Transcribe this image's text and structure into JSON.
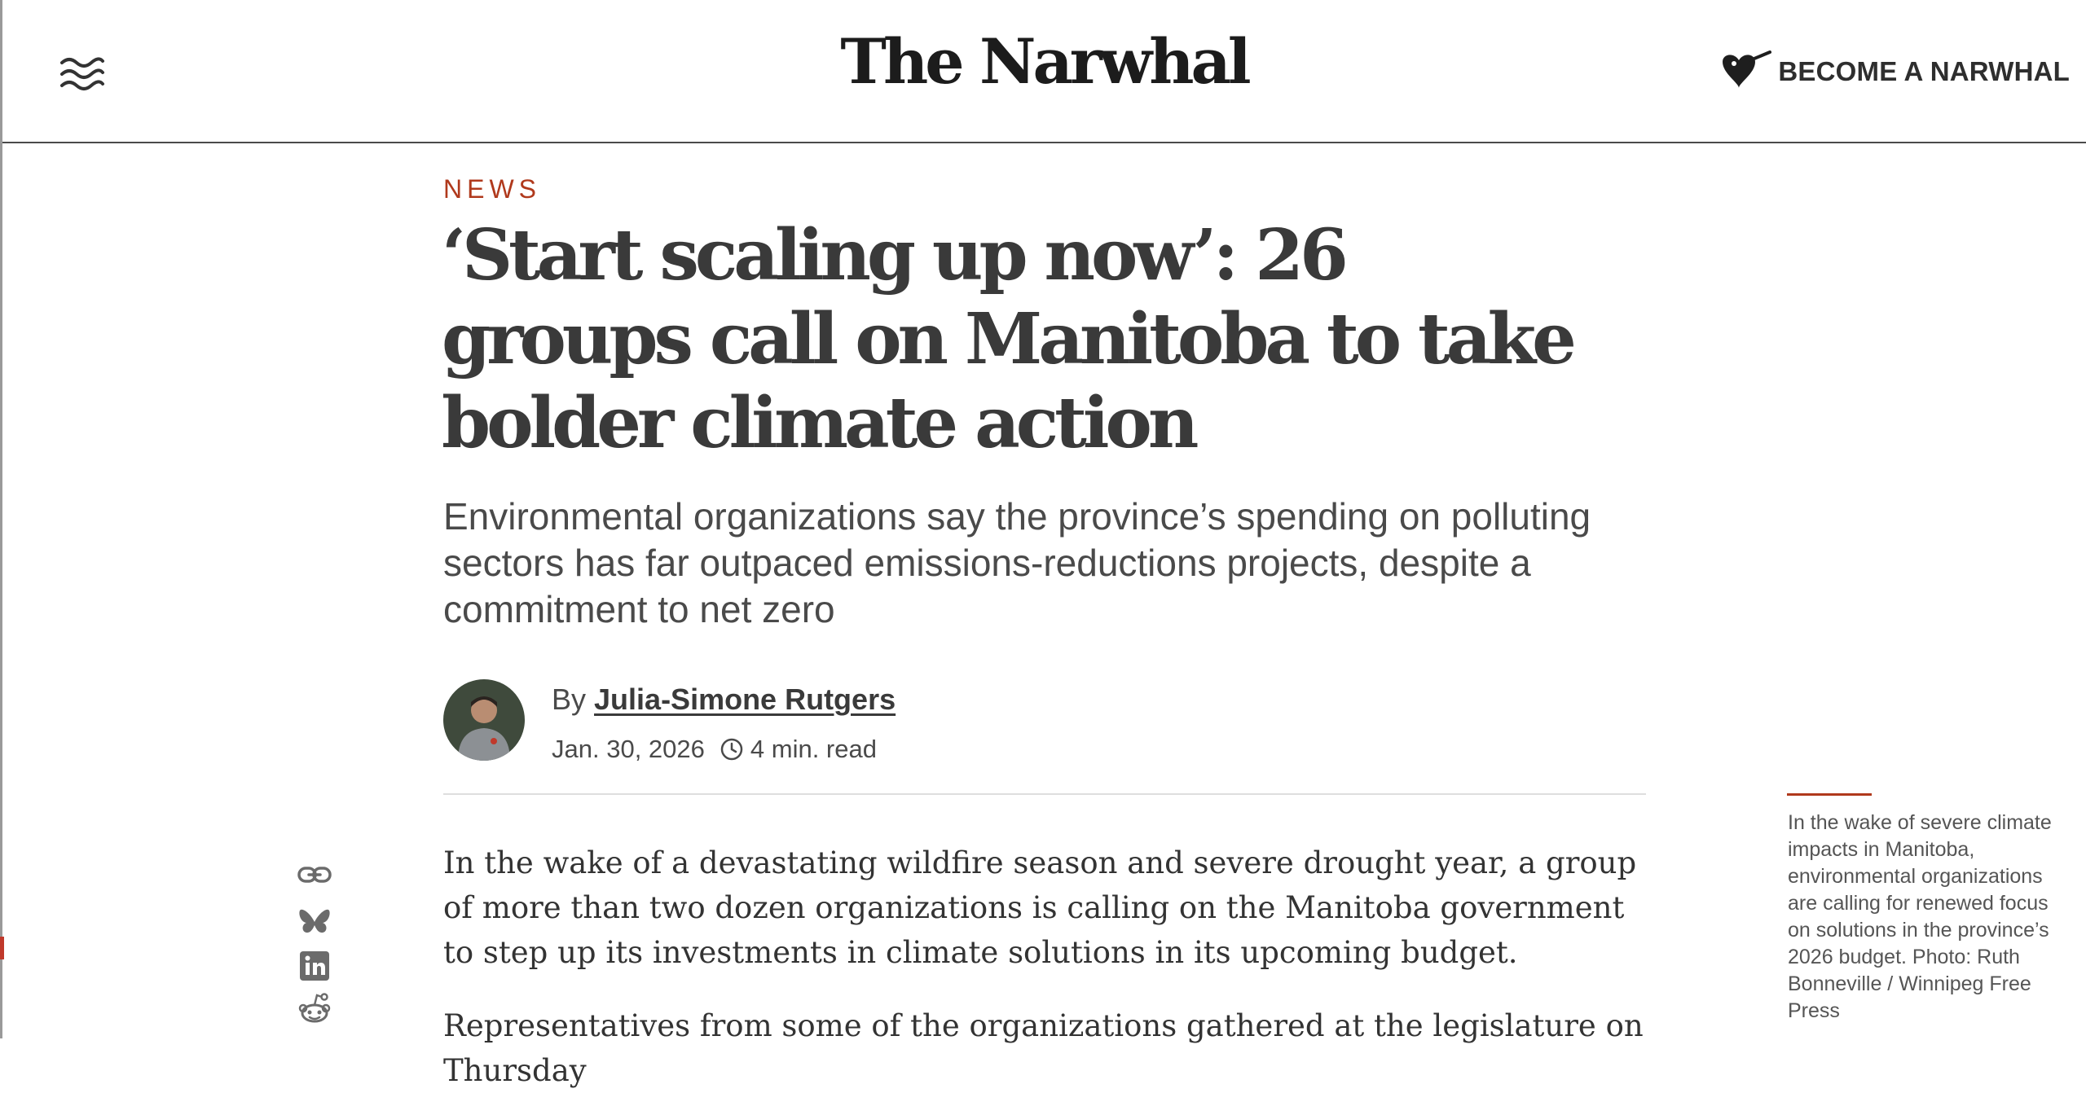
{
  "site": {
    "logo_text": "The Narwhal",
    "cta_label": "BECOME A NARWHAL",
    "menu_icon": "menu-waves-icon",
    "cta_icon": "narwhal-heart-icon"
  },
  "article": {
    "section": "NEWS",
    "headline": "‘Start scaling up now’: 26 groups call on Manitoba to take bolder climate action",
    "dek": "Environmental organizations say the province’s spending on polluting sectors has far outpaced emissions-reductions projects, despite a commitment to net zero",
    "byline_prefix": "By",
    "author": "Julia-Simone Rutgers",
    "date": "Jan. 30, 2026",
    "read_time": "4 min. read",
    "paragraphs": [
      "In the wake of a devastating wildfire season and severe drought year, a group of more than two dozen organizations is calling on the Manitoba government to step up its investments in climate solutions in its upcoming budget.",
      "Representatives from some of the organizations gathered at the legislature on Thursday"
    ]
  },
  "share": {
    "icons": [
      "link-icon",
      "bluesky-icon",
      "linkedin-icon",
      "reddit-icon"
    ]
  },
  "caption": {
    "text": "In the wake of severe climate impacts in Manitoba, environmental organizations are calling for renewed focus on solutions in the province’s 2026 budget. Photo: Ruth Bonneville / Winnipeg Free Press"
  },
  "colors": {
    "accent": "#b0391c",
    "text": "#3a3a3a",
    "share_icons": "#6b6b6b"
  }
}
